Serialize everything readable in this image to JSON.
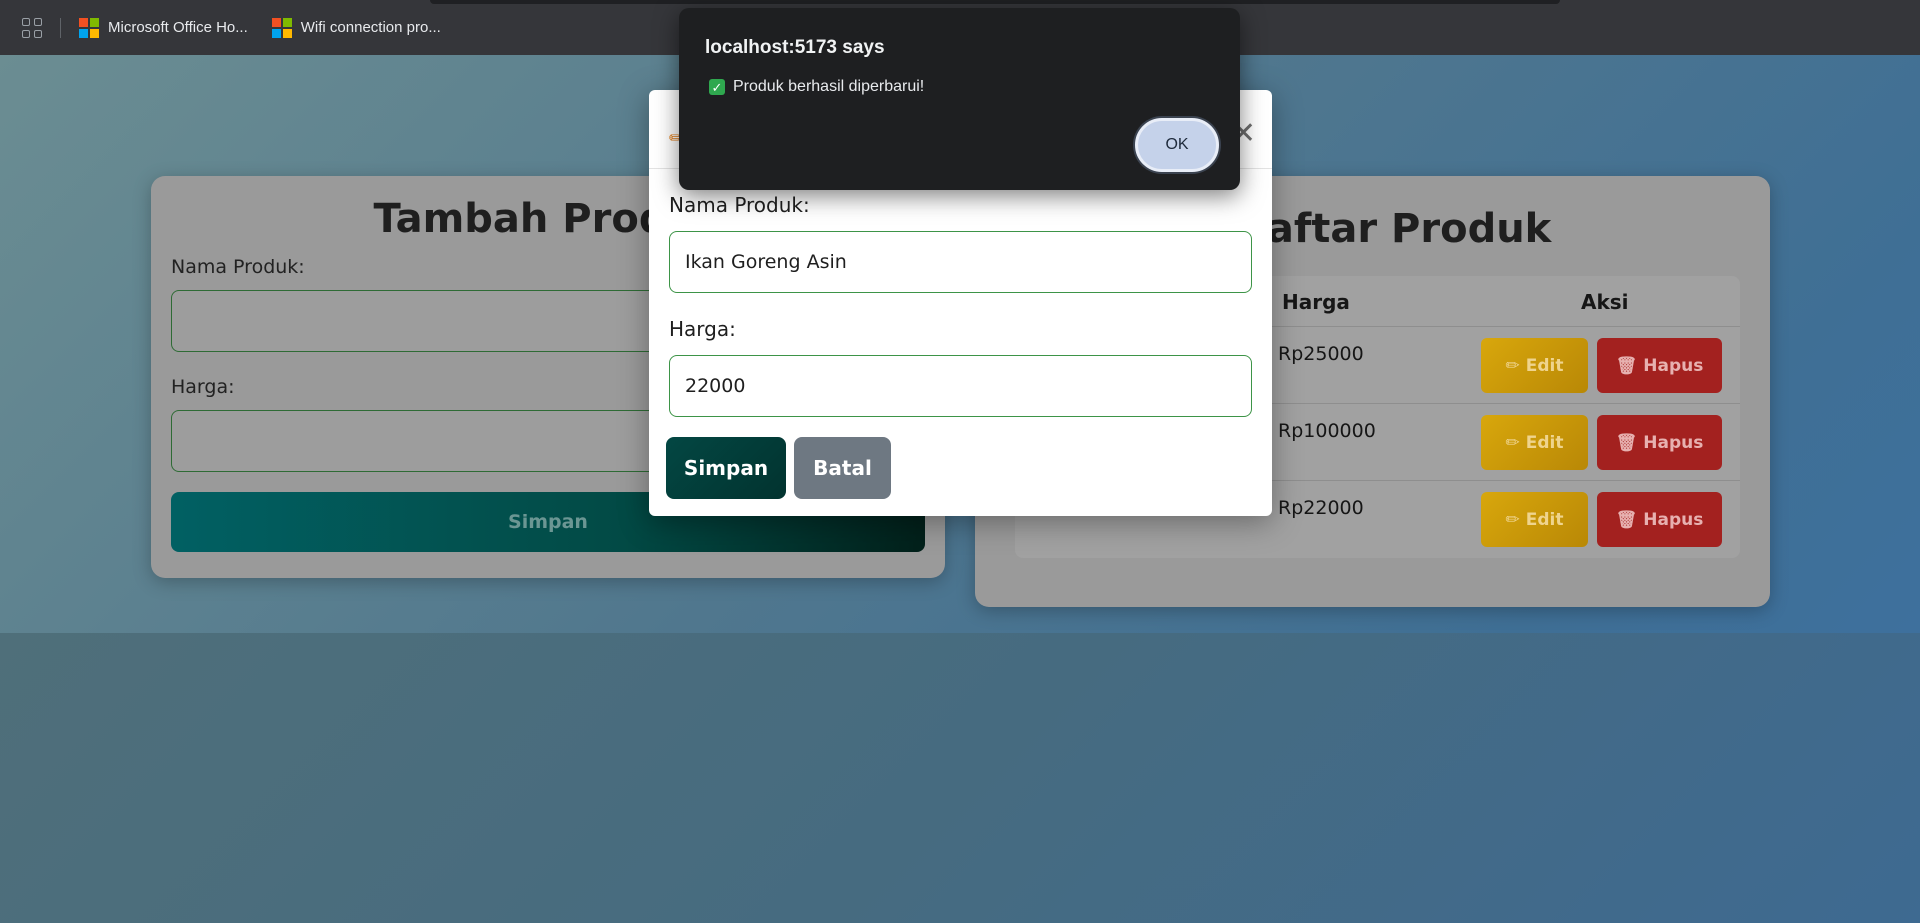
{
  "bookmarks": {
    "apps_icon": "apps-grid-icon",
    "items": [
      {
        "label": "Microsoft Office Ho...",
        "icon": "microsoft-logo-icon"
      },
      {
        "label": "Wifi connection pro...",
        "icon": "microsoft-logo-icon"
      }
    ]
  },
  "add_form": {
    "title": "Tambah Produk",
    "name_label": "Nama Produk:",
    "price_label": "Harga:",
    "name_value": "",
    "price_value": "",
    "save_label": "Simpan"
  },
  "product_list": {
    "title": "Daftar Produk",
    "columns": [
      "Harga",
      "Aksi"
    ],
    "rows": [
      {
        "price": "Rp25000",
        "edit_label": "Edit",
        "delete_label": "Hapus"
      },
      {
        "price": "Rp100000",
        "edit_label": "Edit",
        "delete_label": "Hapus"
      },
      {
        "price": "Rp22000",
        "edit_label": "Edit",
        "delete_label": "Hapus"
      }
    ]
  },
  "edit_modal": {
    "name_label": "Nama Produk:",
    "name_value": "Ikan Goreng Asin",
    "price_label": "Harga:",
    "price_value": "22000",
    "save_label": "Simpan",
    "cancel_label": "Batal",
    "close_icon": "close-icon"
  },
  "alert": {
    "title": "localhost:5173 says",
    "message": "Produk berhasil diperbarui!",
    "ok_label": "OK"
  },
  "colors": {
    "primary_teal": "#034743",
    "edit_yellow": "#d8a70c",
    "delete_red": "#a3211f",
    "cancel_gray": "#6e7882",
    "input_border": "#3d9447"
  }
}
